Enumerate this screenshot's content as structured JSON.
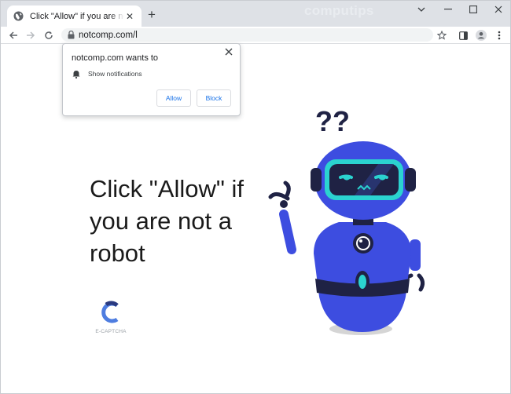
{
  "browser": {
    "tab_title": "Click \"Allow\" if you are not a robot",
    "tab_close": "✕",
    "newtab": "+",
    "watermark": "computips",
    "url": "notcomp.com/l",
    "win_min": "⌄",
    "win_minimize": "—",
    "win_max": "☐",
    "win_close": "✕"
  },
  "popup": {
    "title": "notcomp.com wants to",
    "permission": "Show notifications",
    "allow": "Allow",
    "block": "Block",
    "close": "✕"
  },
  "page": {
    "headline": "Click \"Allow\" if you are not a robot",
    "captcha_label": "E-CAPTCHA",
    "question_marks": "??"
  },
  "colors": {
    "robot_body": "#3d4de0",
    "robot_dark": "#1f2244",
    "visor": "#2bd3d0",
    "accent_blue": "#1a73e8"
  }
}
